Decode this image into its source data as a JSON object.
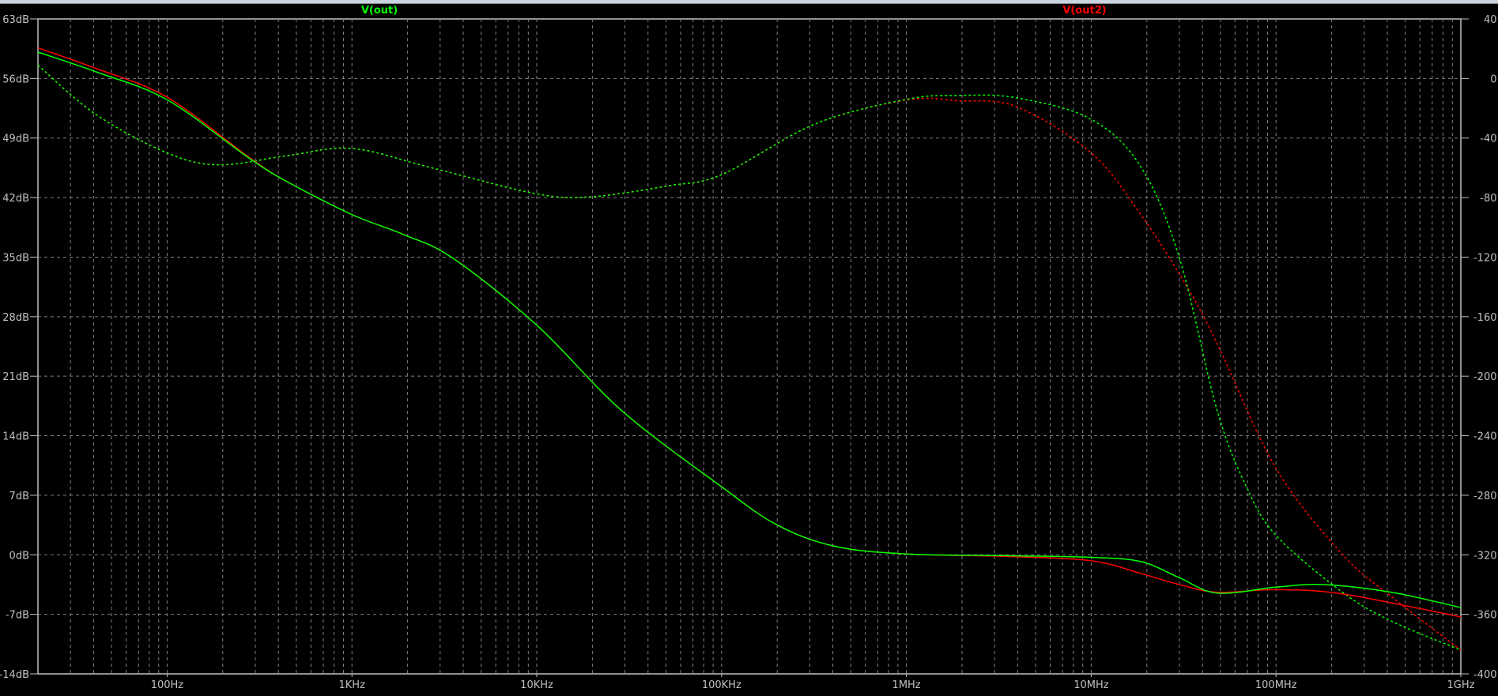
{
  "chart_data": {
    "type": "line",
    "title": "",
    "xscale": "log",
    "xlim": [
      20,
      1000000000
    ],
    "ylim_left": [
      -14,
      63
    ],
    "ylim_right": [
      -400,
      40
    ],
    "grid": true,
    "x_ticks": [
      {
        "value": 100,
        "label": "100Hz"
      },
      {
        "value": 1000,
        "label": "1KHz"
      },
      {
        "value": 10000,
        "label": "10KHz"
      },
      {
        "value": 100000,
        "label": "100KHz"
      },
      {
        "value": 1000000,
        "label": "1MHz"
      },
      {
        "value": 10000000,
        "label": "10MHz"
      },
      {
        "value": 100000000,
        "label": "100MHz"
      },
      {
        "value": 1000000000,
        "label": "1GHz"
      }
    ],
    "y_ticks_left": [
      {
        "value": 63,
        "label": "63dB"
      },
      {
        "value": 56,
        "label": "56dB"
      },
      {
        "value": 49,
        "label": "49dB"
      },
      {
        "value": 42,
        "label": "42dB"
      },
      {
        "value": 35,
        "label": "35dB"
      },
      {
        "value": 28,
        "label": "28dB"
      },
      {
        "value": 21,
        "label": "21dB"
      },
      {
        "value": 14,
        "label": "14dB"
      },
      {
        "value": 7,
        "label": "7dB"
      },
      {
        "value": 0,
        "label": "0dB"
      },
      {
        "value": -7,
        "label": "-7dB"
      },
      {
        "value": -14,
        "label": "-14dB"
      }
    ],
    "y_ticks_right": [
      {
        "value": 40,
        "label": "40°"
      },
      {
        "value": 0,
        "label": "0°"
      },
      {
        "value": -40,
        "label": "-40°"
      },
      {
        "value": -80,
        "label": "-80°"
      },
      {
        "value": -120,
        "label": "-120°"
      },
      {
        "value": -160,
        "label": "-160°"
      },
      {
        "value": -200,
        "label": "-200°"
      },
      {
        "value": -240,
        "label": "-240°"
      },
      {
        "value": -280,
        "label": "-280°"
      },
      {
        "value": -320,
        "label": "-320°"
      },
      {
        "value": -360,
        "label": "-360°"
      },
      {
        "value": -400,
        "label": "-400°"
      }
    ],
    "series": [
      {
        "name": "V(out)",
        "color": "#00ff00",
        "magnitude_db": [
          [
            20,
            59.1
          ],
          [
            41,
            56.8
          ],
          [
            100,
            53.5
          ],
          [
            275,
            46.7
          ],
          [
            443,
            43.9
          ],
          [
            1000,
            40.0
          ],
          [
            1880,
            37.7
          ],
          [
            3500,
            34.9
          ],
          [
            10000,
            27.0
          ],
          [
            29000,
            16.9
          ],
          [
            100000,
            8.0
          ],
          [
            200000,
            3.5
          ],
          [
            410000,
            1.0
          ],
          [
            1000000,
            0.1
          ],
          [
            3500000,
            -0.1
          ],
          [
            10000000,
            -0.3
          ],
          [
            18600000,
            -0.8
          ],
          [
            30000000,
            -2.7
          ],
          [
            48000000,
            -4.5
          ],
          [
            100000000,
            -3.8
          ],
          [
            180000000,
            -3.5
          ],
          [
            420000000,
            -4.4
          ],
          [
            1000000000,
            -6.2
          ]
        ],
        "phase_deg": [
          [
            20,
            9
          ],
          [
            41,
            -24
          ],
          [
            100,
            -50
          ],
          [
            190,
            -58
          ],
          [
            440,
            -52
          ],
          [
            1000,
            -47
          ],
          [
            2700,
            -60
          ],
          [
            10000,
            -77.5
          ],
          [
            20000,
            -79.4
          ],
          [
            52000,
            -72
          ],
          [
            100000,
            -64.6
          ],
          [
            320000,
            -30.6
          ],
          [
            1000000,
            -14
          ],
          [
            1930000,
            -11.4
          ],
          [
            3950000,
            -13
          ],
          [
            10000000,
            -27.4
          ],
          [
            18600000,
            -59.5
          ],
          [
            30000000,
            -120.5
          ],
          [
            48000000,
            -223
          ],
          [
            69000000,
            -274
          ],
          [
            100000000,
            -307
          ],
          [
            228000000,
            -345
          ],
          [
            420000000,
            -364.5
          ],
          [
            1000000000,
            -384
          ]
        ]
      },
      {
        "name": "V(out2)",
        "color": "#ff0000",
        "magnitude_db": [
          [
            20,
            59.6
          ],
          [
            41,
            57.2
          ],
          [
            100,
            53.8
          ],
          [
            275,
            46.8
          ],
          [
            443,
            43.9
          ],
          [
            1000,
            40.0
          ],
          [
            1880,
            37.7
          ],
          [
            3500,
            34.9
          ],
          [
            10000,
            27.0
          ],
          [
            29000,
            16.9
          ],
          [
            100000,
            8.0
          ],
          [
            200000,
            3.5
          ],
          [
            410000,
            1.0
          ],
          [
            1000000,
            0.1
          ],
          [
            3500000,
            -0.2
          ],
          [
            10000000,
            -0.7
          ],
          [
            18600000,
            -2.2
          ],
          [
            30000000,
            -3.5
          ],
          [
            48000000,
            -4.4
          ],
          [
            100000000,
            -4.1
          ],
          [
            228000000,
            -4.6
          ],
          [
            1000000000,
            -7.3
          ]
        ],
        "phase_deg": [
          [
            20,
            9
          ],
          [
            41,
            -24
          ],
          [
            100,
            -50
          ],
          [
            190,
            -58
          ],
          [
            440,
            -52
          ],
          [
            1000,
            -47
          ],
          [
            2700,
            -60
          ],
          [
            10000,
            -77.5
          ],
          [
            20000,
            -79.4
          ],
          [
            52000,
            -72
          ],
          [
            100000,
            -64.6
          ],
          [
            320000,
            -30.6
          ],
          [
            1000000,
            -14.5
          ],
          [
            1930000,
            -15
          ],
          [
            3950000,
            -19
          ],
          [
            10000000,
            -50
          ],
          [
            18600000,
            -91.6
          ],
          [
            33000000,
            -140
          ],
          [
            48000000,
            -178
          ],
          [
            100000000,
            -262
          ],
          [
            228000000,
            -319.5
          ],
          [
            420000000,
            -348
          ],
          [
            1000000000,
            -384
          ]
        ]
      }
    ]
  }
}
